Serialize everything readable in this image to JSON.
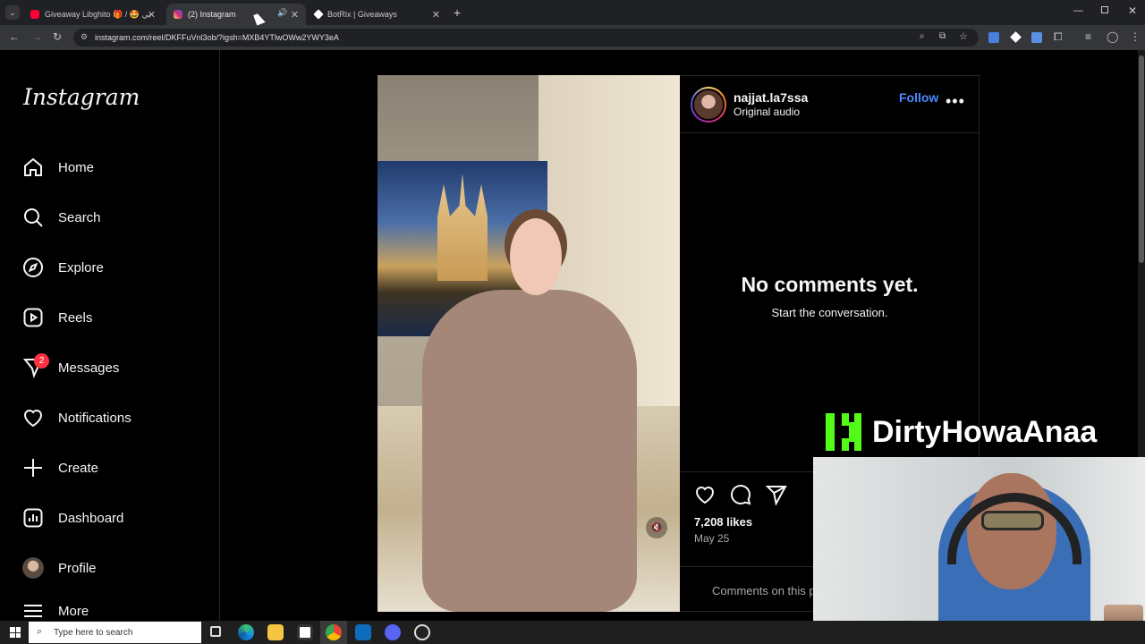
{
  "browser": {
    "tabs": [
      {
        "title": "Giveaway Libghito 🎁 / 🤩 البي",
        "icon": "youtube-icon",
        "color": "#ff0033"
      },
      {
        "title": "(2) Instagram",
        "icon": "instagram-icon",
        "color": "#e1306c"
      },
      {
        "title": "BotRix | Giveaways",
        "icon": "botrix-icon",
        "color": "#ffffff"
      }
    ],
    "url": "instagram.com/reel/DKFFuVnl3ob/?igsh=MXB4YTlwOWw2YWY3eA"
  },
  "sidebar": {
    "logo": "Instagram",
    "items": [
      {
        "label": "Home",
        "icon": "home-icon"
      },
      {
        "label": "Search",
        "icon": "search-icon"
      },
      {
        "label": "Explore",
        "icon": "compass-icon"
      },
      {
        "label": "Reels",
        "icon": "reels-icon"
      },
      {
        "label": "Messages",
        "icon": "messenger-icon",
        "badge": "2"
      },
      {
        "label": "Notifications",
        "icon": "heart-icon"
      },
      {
        "label": "Create",
        "icon": "plus-icon"
      },
      {
        "label": "Dashboard",
        "icon": "dashboard-icon"
      },
      {
        "label": "Profile",
        "icon": "avatar"
      },
      {
        "label": "More",
        "icon": "menu-icon"
      }
    ]
  },
  "post": {
    "username": "najjat.la7ssa",
    "audio": "Original audio",
    "follow_label": "Follow",
    "no_comments_title": "No comments yet.",
    "no_comments_sub": "Start the conversation.",
    "likes": "7,208 likes",
    "date": "May 25",
    "comment_placeholder": "Comments on this post have been limited."
  },
  "overlay": {
    "streamer_name": "DirtyHowaAnaa"
  },
  "taskbar": {
    "search_placeholder": "Type here to search"
  },
  "colors": {
    "accent_blue": "#0095f6",
    "badge_red": "#ff3040",
    "kick_green": "#53fc18"
  }
}
